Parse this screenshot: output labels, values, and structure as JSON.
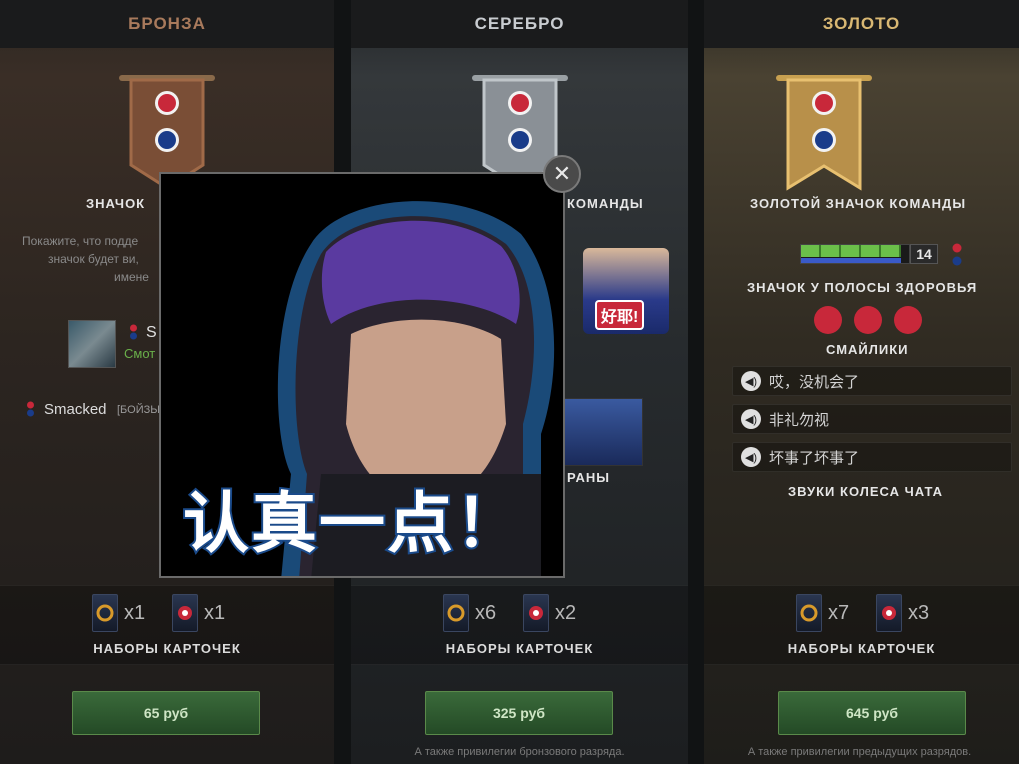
{
  "tiers": {
    "bronze": {
      "title": "БРОНЗА",
      "badge_title_partial": "ЗНАЧОК",
      "badge_title_right": "",
      "desc_line1": "Покажите, что подде",
      "desc_line2": "значок будет ви,",
      "desc_line3": "имене",
      "profile_name_partial": "S",
      "profile_status_partial": "Смот",
      "chat_name": "Smacked",
      "chat_tag": "[БОЙЗЫ",
      "pack1_count": "x1",
      "pack2_count": "x1",
      "cards_label": "НАБОРЫ КАРТОЧЕК",
      "price": "65 руб"
    },
    "silver": {
      "title": "СЕРЕБРО",
      "badge_title_partial": "КОМАНДЫ",
      "sticker_text": "好耶!",
      "team_label_partial": "РАНЫ",
      "pack1_count": "x6",
      "pack2_count": "x2",
      "cards_label": "НАБОРЫ КАРТОЧЕК",
      "price": "325 руб",
      "footnote": "А также привилегии бронзового разряда."
    },
    "gold": {
      "title": "ЗОЛОТО",
      "badge_title": "ЗОЛОТОЙ ЗНАЧОК КОМАНДЫ",
      "hp_level": "14",
      "hp_label": "ЗНАЧОК У ПОЛОСЫ ЗДОРОВЬЯ",
      "emotes_label": "СМАЙЛИКИ",
      "sounds": [
        "哎，没机会了",
        "非礼勿视",
        "坏事了坏事了"
      ],
      "sounds_label": "ЗВУКИ КОЛЕСА ЧАТА",
      "pack1_count": "x7",
      "pack2_count": "x3",
      "cards_label": "НАБОРЫ КАРТОЧЕК",
      "price": "645 руб",
      "footnote": "А также привилегии предыдущих разрядов."
    }
  },
  "modal": {
    "caption": "认真一点！",
    "close_symbol": "✕"
  },
  "colors": {
    "bronze": "#a87a5c",
    "silver": "#c8ccd0",
    "gold": "#d9b873",
    "button_green": "#2f5a30",
    "hp_green": "#6bc04a"
  },
  "icons": [
    "banner-icon",
    "team-logo-icon",
    "speaker-icon",
    "card-pack-icon",
    "close-icon"
  ]
}
